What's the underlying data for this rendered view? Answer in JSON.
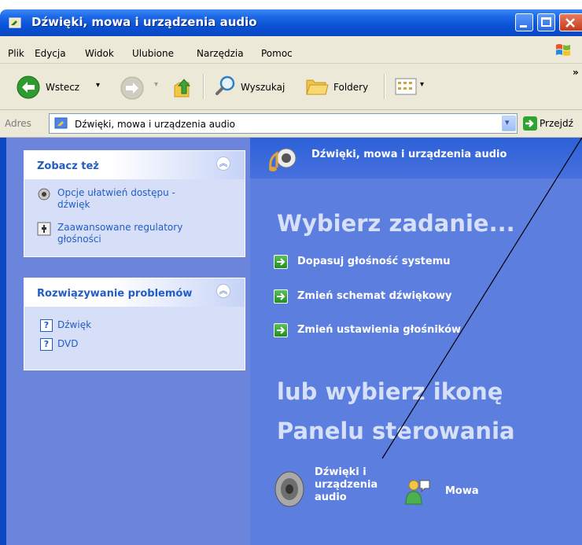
{
  "window": {
    "title": "Dźwięki, mowa i urządzenia audio"
  },
  "menu": [
    "Plik",
    "Edycja",
    "Widok",
    "Ulubione",
    "Narzędzia",
    "Pomoc"
  ],
  "toolbar": {
    "back_label": "Wstecz",
    "search_label": "Wyszukaj",
    "folders_label": "Foldery",
    "chevron": "»"
  },
  "address": {
    "label": "Adres",
    "value": "Dźwięki, mowa i urządzenia audio",
    "go_label": "Przejdź"
  },
  "see_also": {
    "title": "Zobacz też",
    "items": [
      "Opcje ułatwień dostępu -\ndźwięk",
      "Zaawansowane regulatory\ngłośności"
    ]
  },
  "troubleshoot": {
    "title": "Rozwiązywanie problemów",
    "items": [
      "Dźwięk",
      "DVD"
    ]
  },
  "category": {
    "title": "Dźwięki, mowa i urządzenia audio",
    "pick_task": "Wybierz zadanie...",
    "tasks": [
      "Dopasuj głośność systemu",
      "Zmień schemat dźwiękowy",
      "Zmień ustawienia głośników"
    ],
    "or_pick_line1": "lub wybierz ikonę",
    "or_pick_line2": "Panelu sterowania",
    "icons": [
      "Dźwięki i\nurządzenia\naudio",
      "Mowa"
    ]
  }
}
